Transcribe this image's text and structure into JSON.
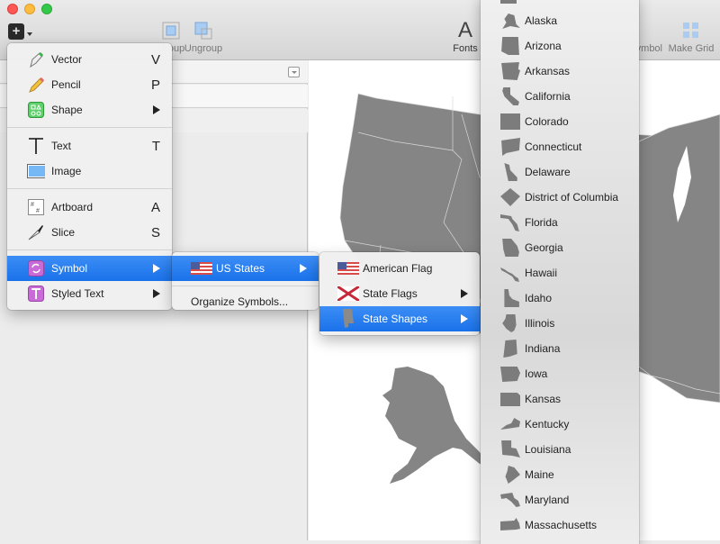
{
  "window": {
    "traffic_lights": [
      "close",
      "minimize",
      "maximize"
    ]
  },
  "toolbar": {
    "insert_icon": "plus-icon",
    "group_label": "Group",
    "ungroup_label": "Ungroup",
    "fonts_label": "Fonts",
    "fonts_glyph": "A",
    "symbol_label": "Symbol",
    "make_grid_label": "Make Grid"
  },
  "insert_menu": {
    "items": [
      {
        "label": "Vector",
        "shortcut": "V",
        "icon": "pen-icon"
      },
      {
        "label": "Pencil",
        "shortcut": "P",
        "icon": "pencil-icon"
      },
      {
        "label": "Shape",
        "submenu": true,
        "icon": "shape-icon"
      },
      {
        "label": "Text",
        "shortcut": "T",
        "icon": "text-icon"
      },
      {
        "label": "Image",
        "icon": "image-icon"
      },
      {
        "label": "Artboard",
        "shortcut": "A",
        "icon": "artboard-icon"
      },
      {
        "label": "Slice",
        "shortcut": "S",
        "icon": "slice-icon"
      },
      {
        "label": "Symbol",
        "submenu": true,
        "selected": true,
        "icon": "symbol-icon"
      },
      {
        "label": "Styled Text",
        "submenu": true,
        "icon": "styled-text-icon"
      }
    ]
  },
  "symbol_menu": {
    "items": [
      {
        "label": "US States",
        "submenu": true,
        "selected": true,
        "icon": "us-flag-icon"
      },
      {
        "label": "Organize Symbols..."
      }
    ]
  },
  "us_states_menu": {
    "items": [
      {
        "label": "American Flag",
        "icon": "us-flag-icon"
      },
      {
        "label": "State Flags",
        "submenu": true,
        "icon": "alabama-flag-icon"
      },
      {
        "label": "State Shapes",
        "submenu": true,
        "selected": true,
        "icon": "alabama-shape-icon"
      }
    ]
  },
  "state_shapes_menu": {
    "items": [
      "Alaska",
      "Arizona",
      "Arkansas",
      "California",
      "Colorado",
      "Connecticut",
      "Delaware",
      "District of Columbia",
      "Florida",
      "Georgia",
      "Hawaii",
      "Idaho",
      "Illinois",
      "Indiana",
      "Iowa",
      "Kansas",
      "Kentucky",
      "Louisiana",
      "Maine",
      "Maryland",
      "Massachusetts"
    ]
  },
  "colors": {
    "selection": "#1a72ea",
    "map_fill": "#858585"
  }
}
